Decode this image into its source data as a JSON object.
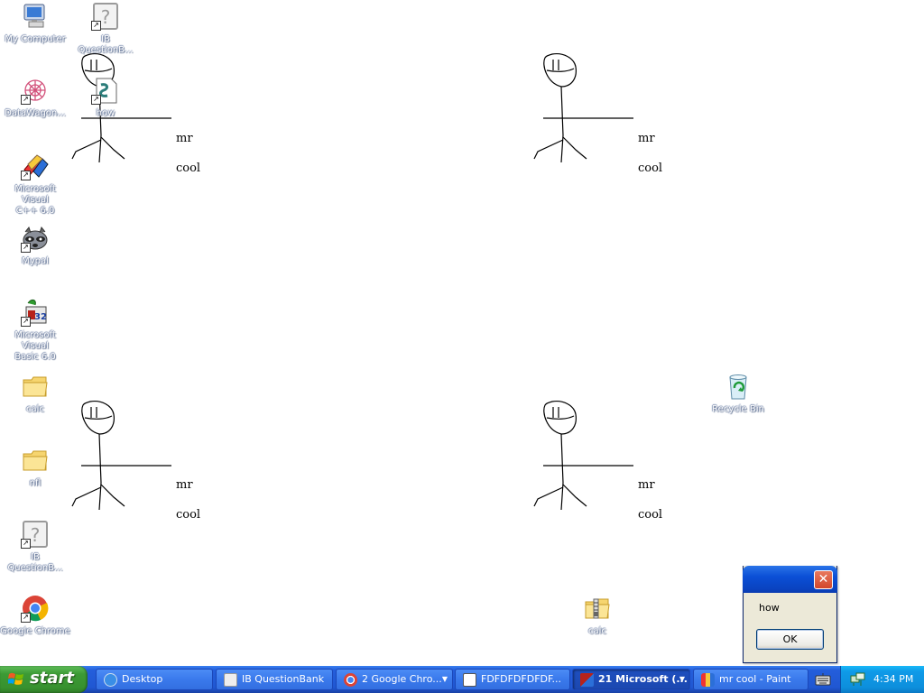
{
  "wallpaper": {
    "labels": [
      {
        "line1": "mr",
        "line2": "cool"
      },
      {
        "line1": "mr",
        "line2": "cool"
      },
      {
        "line1": "mr",
        "line2": "cool"
      },
      {
        "line1": "mr",
        "line2": "cool"
      }
    ]
  },
  "desktop_icons": [
    {
      "label": "My Computer",
      "icon": "my-computer-icon"
    },
    {
      "label": "IB\nQuestionB...",
      "icon": "unknown-file-icon"
    },
    {
      "label": "how",
      "icon": "script-file-icon"
    },
    {
      "label": "DataWagon...",
      "icon": "datawagon-icon"
    },
    {
      "label": "Microsoft Visual\nC++ 6.0",
      "icon": "visual-cpp-icon"
    },
    {
      "label": "Mypal",
      "icon": "mypal-icon"
    },
    {
      "label": "Microsoft Visual\nBasic 6.0",
      "icon": "visual-basic-icon"
    },
    {
      "label": "calc",
      "icon": "folder-icon"
    },
    {
      "label": "nfl",
      "icon": "folder-icon"
    },
    {
      "label": "IB\nQuestionB...",
      "icon": "unknown-file-icon"
    },
    {
      "label": "Google Chrome",
      "icon": "chrome-icon"
    },
    {
      "label": "Recycle Bin",
      "icon": "recycle-bin-icon"
    },
    {
      "label": "calc",
      "icon": "zip-folder-icon"
    }
  ],
  "dialog": {
    "message": "how",
    "ok_label": "OK",
    "close_glyph": "✕"
  },
  "taskbar": {
    "start_label": "start",
    "buttons": [
      {
        "label": "Desktop",
        "icon": "desktop-icon"
      },
      {
        "label": "IB QuestionBank",
        "icon": "unknown-file-icon"
      },
      {
        "label": "2 Google Chro...",
        "icon": "chrome-icon",
        "group_arrow": "▼"
      },
      {
        "label": "FDFDFDFDFDF...",
        "icon": "document-icon"
      },
      {
        "label": "21 Microsoft (...",
        "icon": "visual-basic-icon",
        "group_arrow": "▼"
      },
      {
        "label": "mr cool - Paint",
        "icon": "paint-icon"
      }
    ],
    "clock": "4:34 PM"
  },
  "colors": {
    "taskbar_blue": "#245edb",
    "start_green": "#3c9a35",
    "tray_blue": "#0f9ae8",
    "dialog_bg": "#ece9d8",
    "close_red": "#d2462a"
  }
}
